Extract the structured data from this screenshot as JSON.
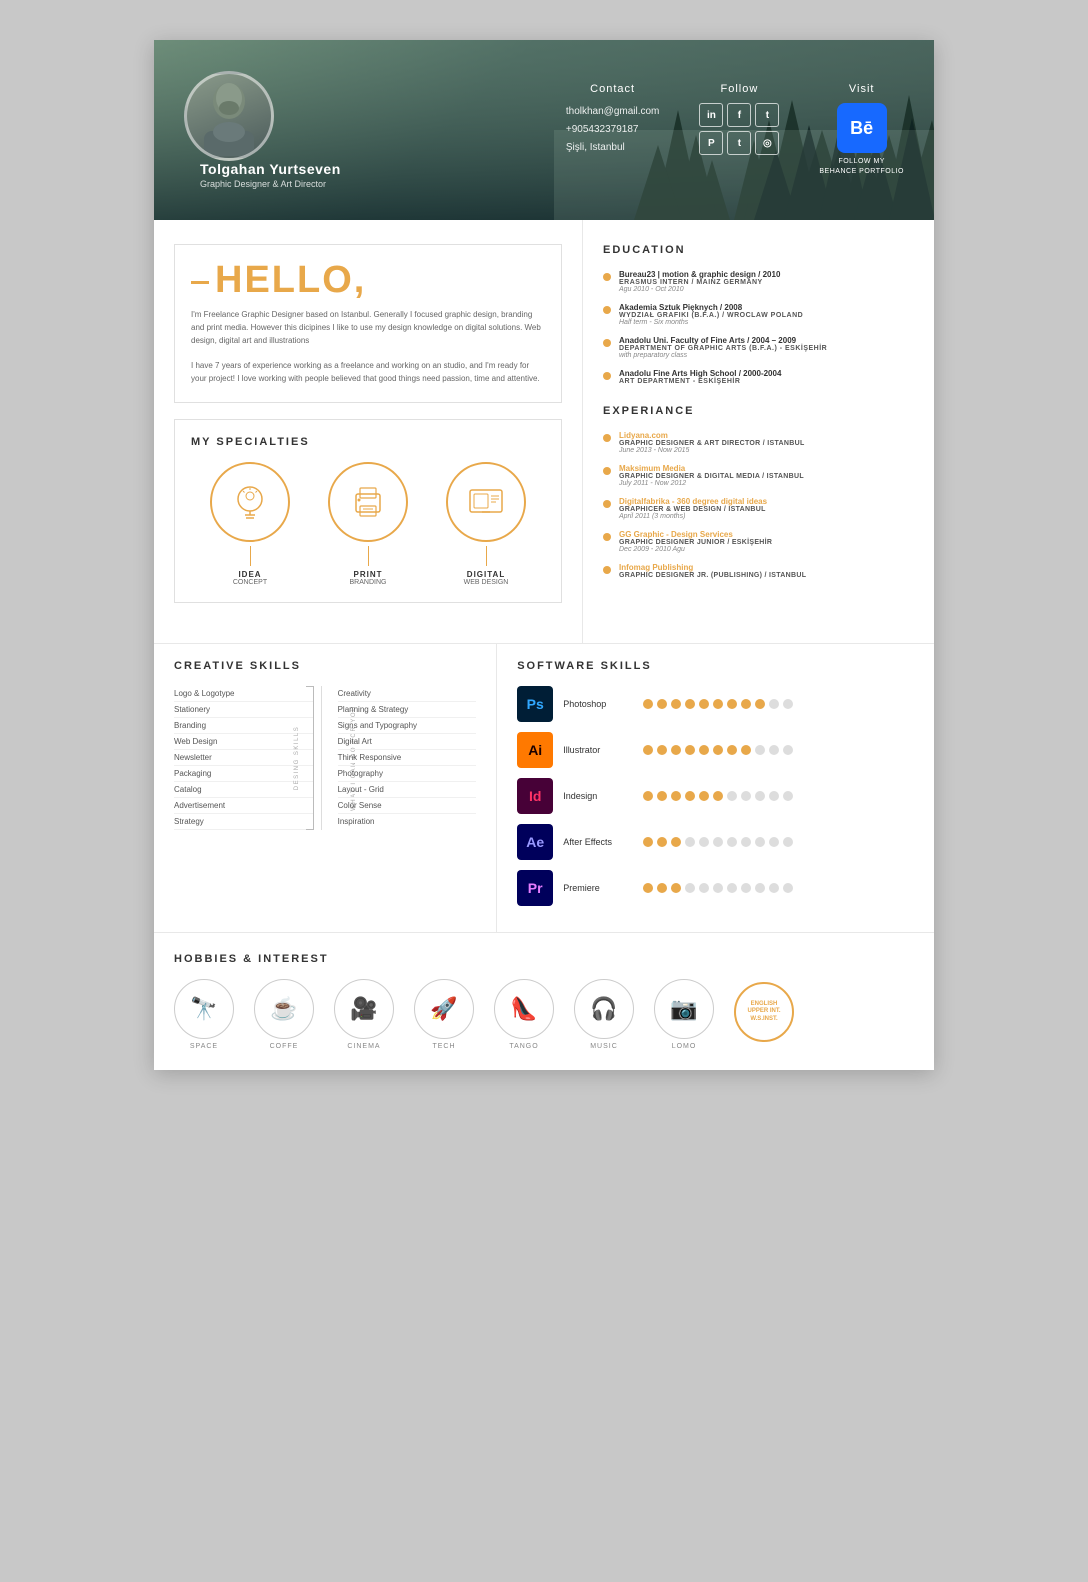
{
  "header": {
    "name": "Tolgahan Yurtseven",
    "title": "Graphic Designer & Art Director",
    "contact_label": "Contact",
    "email": "tholkhan@gmail.com",
    "phone": "+905432379187",
    "location": "Şişli, Istanbul",
    "follow_label": "Follow",
    "visit_label": "Visit",
    "behance_text": "FOLLOW MY\nBEHANCE PORTFOLIO",
    "social": [
      "in",
      "f",
      "t",
      "P",
      "t",
      "📷"
    ]
  },
  "hello": {
    "title": "HELLO,",
    "dash": "—",
    "para1": "I'm Freelance Graphic Designer based on Istanbul. Generally I focused graphic design, branding and print media. However this dicipines I like to use my design knowledge on digital solutions. Web design, digital art and illustrations",
    "para2": "I have 7 years of experience working as a freelance and working on an studio, and I'm ready for your project! I love working with people believed that good things need passion, time and attentive."
  },
  "specialties": {
    "title": "MY SPECIALTIES",
    "items": [
      {
        "label": "IDEA",
        "sub": "CONCEPT",
        "icon": "💡"
      },
      {
        "label": "PRINT",
        "sub": "BRANDING",
        "icon": "🖨"
      },
      {
        "label": "DIGITAL",
        "sub": "WEB DESIGN",
        "icon": "🖥"
      }
    ]
  },
  "education": {
    "title": "EDUCATION",
    "items": [
      {
        "name": "Bureau23 | motion & graphic design / 2010",
        "sub": "ERASMUS INTERN / MAINZ GERMANY",
        "date": "Agu 2010 - Oct 2010"
      },
      {
        "name": "Akademia Sztuk Pięknych / 2008",
        "sub": "WYDZIAŁ GRAFIKI (B.F.A.) / WROCLAW POLAND",
        "date": "Half term - Six months"
      },
      {
        "name": "Anadolu Uni. Faculty of Fine Arts / 2004 – 2009",
        "sub": "DEPARTMENT OF GRAPHIC ARTS (B.F.A.) - ESKİŞEHİR",
        "date": "with preparatory class"
      },
      {
        "name": "Anadolu Fine Arts High School / 2000-2004",
        "sub": "ART DEPARTMENT - ESKİŞEHİR",
        "date": ""
      }
    ]
  },
  "experience": {
    "title": "EXPERIANCE",
    "items": [
      {
        "name": "Lidyana.com",
        "role": "GRAPHIC DESIGNER & ART DIRECTOR / ISTANBUL",
        "date": "June 2013 - Now 2015"
      },
      {
        "name": "Maksimum Media",
        "role": "GRAPHIC DESIGNER & DIGITAL MEDIA / ISTANBUL",
        "date": "July 2011 - Now 2012"
      },
      {
        "name": "Digitalfabrika - 360 degree digital ideas",
        "role": "GRAPHICER & WEB DESIGN / ISTANBUL",
        "date": "April 2011 (3 months)"
      },
      {
        "name": "GG Graphic - Design Services",
        "role": "GRAPHIC DESIGNER JUNIOR / ESKİŞEHİR",
        "date": "Dec 2009 - 2010 Agu"
      },
      {
        "name": "Infomag Publishing",
        "role": "GRAPHIC DESIGNER JR. (PUBLISHING) / ISTANBUL",
        "date": ""
      }
    ]
  },
  "creative_skills": {
    "title": "CREATIVE SKILLS",
    "left_label": "WHAT I CAN DO FOR YOU",
    "right_label": "DESING SKILLS",
    "col_a": [
      "Logo & Logotype",
      "Stationery",
      "Branding",
      "Web Design",
      "Newsletter",
      "Packaging",
      "Catalog",
      "Advertisement",
      "Strategy"
    ],
    "col_b": [
      "Creativity",
      "Planning & Strategy",
      "Signs and Typography",
      "Digital Art",
      "Think Responsive",
      "Photography",
      "Layout - Grid",
      "Color Sense",
      "Inspiration"
    ]
  },
  "software_skills": {
    "title": "SOFTWARE SKILLS",
    "items": [
      {
        "name": "Photoshop",
        "abbr": "Ps",
        "bg": "ps",
        "filled": 9,
        "empty": 2
      },
      {
        "name": "Illustrator",
        "abbr": "Ai",
        "bg": "ai",
        "filled": 8,
        "empty": 3
      },
      {
        "name": "Indesign",
        "abbr": "Id",
        "bg": "id",
        "filled": 6,
        "empty": 5
      },
      {
        "name": "After Effects",
        "abbr": "Ae",
        "bg": "ae",
        "filled": 3,
        "empty": 8
      },
      {
        "name": "Premiere",
        "abbr": "Pr",
        "bg": "pr",
        "filled": 3,
        "empty": 8
      }
    ]
  },
  "hobbies": {
    "title": "HOBBIES & INTEREST",
    "items": [
      {
        "label": "SPACE",
        "icon": "🔭"
      },
      {
        "label": "COFFE",
        "icon": "☕"
      },
      {
        "label": "CINEMA",
        "icon": "🎥"
      },
      {
        "label": "TECH",
        "icon": "🚀"
      },
      {
        "label": "TANGO",
        "icon": "👠"
      },
      {
        "label": "MUSIC",
        "icon": "🎧"
      },
      {
        "label": "LOMO",
        "icon": "📷"
      }
    ],
    "english": {
      "label": "ENGLISH\nUPPER INT.\nW.S.INST."
    }
  }
}
